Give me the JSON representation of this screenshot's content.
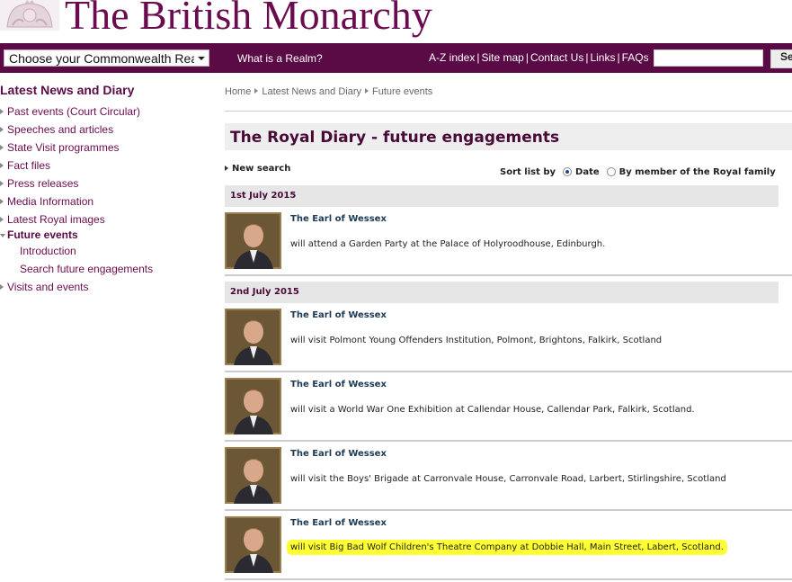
{
  "header": {
    "site_title": "The British Monarchy"
  },
  "nav": {
    "realm_select_value": "Choose your Commonwealth Realm",
    "what_is_realm": "What is a Realm?",
    "util_links": [
      "A-Z index",
      "Site map",
      "Contact Us",
      "Links",
      "FAQs"
    ],
    "search_button": "Se"
  },
  "sidebar": {
    "title": "Latest News and Diary",
    "items": [
      "Past events (Court Circular)",
      "Speeches and articles",
      "State Visit programmes",
      "Fact files",
      "Press releases",
      "Media Information",
      "Latest Royal images"
    ],
    "active": "Future events",
    "subitems": [
      "Introduction",
      "Search future engagements"
    ],
    "last": "Visits and events"
  },
  "breadcrumb": [
    "Home",
    "Latest News and Diary",
    "Future events"
  ],
  "main": {
    "title": "The Royal Diary - future engagements",
    "new_search": "New search",
    "sort_label": "Sort list by",
    "sort_date": "Date",
    "sort_member": "By member of the Royal family",
    "sort_selected": "Date"
  },
  "days": [
    {
      "date": "1st July 2015",
      "entries": [
        {
          "name": "The Earl of Wessex",
          "desc": "will attend a Garden Party at the Palace of Holyroodhouse, Edinburgh."
        }
      ]
    },
    {
      "date": "2nd July 2015",
      "entries": [
        {
          "name": "The Earl of Wessex",
          "desc": "will visit Polmont Young Offenders Institution, Polmont, Brightons, Falkirk, Scotland"
        },
        {
          "name": "The Earl of Wessex",
          "desc": "will visit a World War One Exhibition at Callendar House, Callendar Park, Falkirk, Scotland."
        },
        {
          "name": "The Earl of Wessex",
          "desc": "will visit the Boys' Brigade at Carronvale House, Carronvale Road, Larbert, Stirlingshire, Scotland"
        },
        {
          "name": "The Earl of Wessex",
          "desc": "will visit Big Bad Wolf Children's Theatre Company at Dobbie Hall, Main Street, Labert, Scotland.",
          "highlighted": true
        }
      ]
    }
  ],
  "colors": {
    "brand": "#5a0a45",
    "title": "#6b0b4f",
    "highlight": "#ffff33"
  }
}
